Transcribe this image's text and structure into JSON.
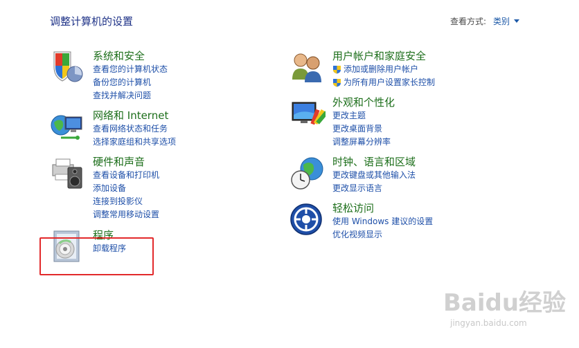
{
  "page": {
    "title": "调整计算机的设置",
    "view_by_label": "查看方式:",
    "view_by_value": "类别"
  },
  "left_column": [
    {
      "title": "系统和安全",
      "icon": "shield-computer-icon",
      "links": [
        "查看您的计算机状态",
        "备份您的计算机",
        "查找并解决问题"
      ]
    },
    {
      "title": "网络和 Internet",
      "icon": "network-globe-icon",
      "links": [
        "查看网络状态和任务",
        "选择家庭组和共享选项"
      ]
    },
    {
      "title": "硬件和声音",
      "icon": "printer-speaker-icon",
      "links": [
        "查看设备和打印机",
        "添加设备",
        "连接到投影仪",
        "调整常用移动设置"
      ]
    },
    {
      "title": "程序",
      "icon": "program-disc-icon",
      "links": [
        "卸载程序"
      ]
    }
  ],
  "right_column": [
    {
      "title": "用户帐户和家庭安全",
      "icon": "users-icon",
      "links": [
        "添加或删除用户帐户",
        "为所有用户设置家长控制"
      ]
    },
    {
      "title": "外观和个性化",
      "icon": "monitor-palette-icon",
      "links": [
        "更改主题",
        "更改桌面背景",
        "调整屏幕分辨率"
      ]
    },
    {
      "title": "时钟、语言和区域",
      "icon": "clock-globe-icon",
      "links": [
        "更改键盘或其他输入法",
        "更改显示语言"
      ]
    },
    {
      "title": "轻松访问",
      "icon": "accessibility-icon",
      "links": [
        "使用 Windows 建议的设置",
        "优化视频显示"
      ]
    }
  ],
  "watermark": {
    "main": "Baidu经验",
    "sub": "jingyan.baidu.com"
  },
  "colors": {
    "title_green": "#1c6e1a",
    "link_blue": "#1e4fa8",
    "heading_blue": "#1e3287",
    "highlight_red": "#e2292b"
  }
}
